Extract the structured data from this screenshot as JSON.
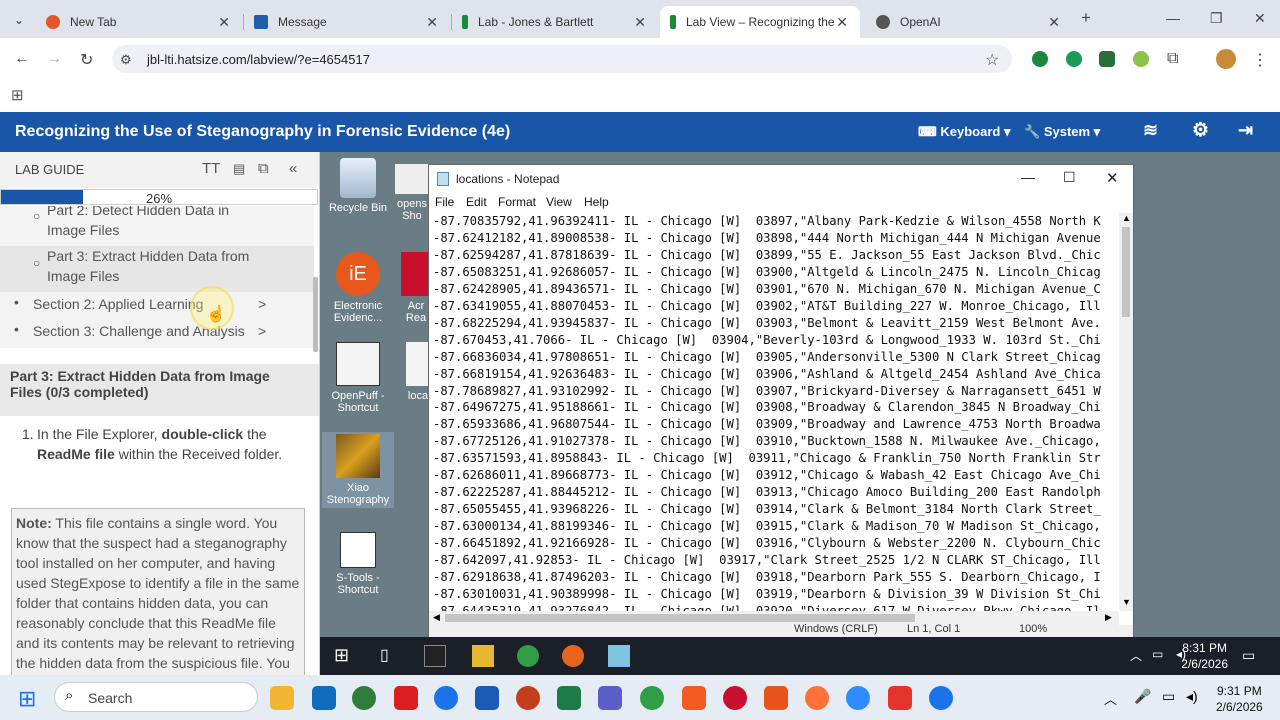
{
  "browser": {
    "tabs": [
      {
        "title": "New Tab",
        "favicon_color": "#e4572e"
      },
      {
        "title": "Message",
        "favicon_color": "#1f5fa8"
      },
      {
        "title": "Lab - Jones & Bartlett",
        "favicon_color": "#1a8a3a"
      },
      {
        "title": "Lab View – Recognizing the",
        "favicon_color": "#1a8a3a"
      },
      {
        "title": "OpenAI",
        "favicon_color": "#555555"
      }
    ],
    "url": "jbl-lti.hatsize.com/labview/?e=4654517"
  },
  "app": {
    "title": "Recognizing the Use of Steganography in Forensic Evidence (4e)",
    "keyboard": "Keyboard",
    "system": "System"
  },
  "lab_guide": {
    "title": "LAB GUIDE",
    "progress_percent": 26,
    "progress_label": "26%",
    "toc": {
      "part2": "Part 2: Detect Hidden Data in Image Files",
      "part3": "Part 3: Extract Hidden Data from Image Files",
      "section2": "Section 2: Applied Learning",
      "section3": "Section 3: Challenge and Analysis"
    },
    "part_heading": "Part 3: Extract Hidden Data from Image Files (0/3 completed)",
    "step_num": "1.",
    "step_pre": "In the File Explorer, ",
    "step_bold1": "double-click",
    "step_mid": " the ",
    "step_bold2": "ReadMe file",
    "step_post": " within the Received folder.",
    "note_label": "Note:",
    "note_text": " This file contains a single word. You know that the suspect had a steganography tool installed on her computer, and having used StegExpose to identify a file in the same folder that contains hidden data, you can reasonably conclude that this ReadMe file and its contents may be relevant to retrieving the hidden data from the suspicious file. You"
  },
  "desktop": {
    "icons": [
      {
        "label": "Recycle Bin"
      },
      {
        "label": "opens Sho"
      },
      {
        "label": "Electronic Evidenc..."
      },
      {
        "label": "Acr Rea"
      },
      {
        "label": "OpenPuff - Shortcut"
      },
      {
        "label": "loca"
      },
      {
        "label": "Xiao Stenography"
      },
      {
        "label": "S-Tools - Shortcut"
      }
    ]
  },
  "notepad": {
    "title": "locations - Notepad",
    "menu": [
      "File",
      "Edit",
      "Format",
      "View",
      "Help"
    ],
    "lines": [
      "-87.70835792,41.96392411- IL - Chicago [W]  03897,\"Albany Park-Kedzie & Wilson_4558 North K",
      "-87.62412182,41.89008538- IL - Chicago [W]  03898,\"444 North Michigan_444 N Michigan Avenue",
      "-87.62594287,41.87818639- IL - Chicago [W]  03899,\"55 E. Jackson_55 East Jackson Blvd._Chic",
      "-87.65083251,41.92686057- IL - Chicago [W]  03900,\"Altgeld & Lincoln_2475 N. Lincoln_Chicag",
      "-87.62428905,41.89436571- IL - Chicago [W]  03901,\"670 N. Michigan_670 N. Michigan Avenue_C",
      "-87.63419055,41.88070453- IL - Chicago [W]  03902,\"AT&T Building_227 W. Monroe_Chicago, Ill",
      "-87.68225294,41.93945837- IL - Chicago [W]  03903,\"Belmont & Leavitt_2159 West Belmont Ave.",
      "-87.670453,41.7066- IL - Chicago [W]  03904,\"Beverly-103rd & Longwood_1933 W. 103rd St._Chi",
      "-87.66836034,41.97808651- IL - Chicago [W]  03905,\"Andersonville_5300 N Clark Street_Chicag",
      "-87.66819154,41.92636483- IL - Chicago [W]  03906,\"Ashland & Altgeld_2454 Ashland Ave_Chica",
      "-87.78689827,41.93102992- IL - Chicago [W]  03907,\"Brickyard-Diversey & Narragansett_6451 W",
      "-87.64967275,41.95188661- IL - Chicago [W]  03908,\"Broadway & Clarendon_3845 N Broadway_Chi",
      "-87.65933686,41.96807544- IL - Chicago [W]  03909,\"Broadway and Lawrence_4753 North Broadwa",
      "-87.67725126,41.91027378- IL - Chicago [W]  03910,\"Bucktown_1588 N. Milwaukee Ave._Chicago,",
      "-87.63571593,41.8958843- IL - Chicago [W]  03911,\"Chicago & Franklin_750 North Franklin Str",
      "-87.62686011,41.89668773- IL - Chicago [W]  03912,\"Chicago & Wabash_42 East Chicago Ave_Chi",
      "-87.62225287,41.88445212- IL - Chicago [W]  03913,\"Chicago Amoco Building_200 East Randolph",
      "-87.65055455,41.93968226- IL - Chicago [W]  03914,\"Clark & Belmont_3184 North Clark Street_",
      "-87.63000134,41.88199346- IL - Chicago [W]  03915,\"Clark & Madison_70 W Madison St_Chicago,",
      "-87.66451892,41.92166928- IL - Chicago [W]  03916,\"Clybourn & Webster_2200 N. Clybourn_Chic",
      "-87.642097,41.92853- IL - Chicago [W]  03917,\"Clark Street_2525 1/2 N CLARK ST_Chicago, Ill",
      "-87.62918638,41.87496203- IL - Chicago [W]  03918,\"Dearborn Park_555 S. Dearborn_Chicago, I",
      "-87.63010031,41.90389998- IL - Chicago [W]  03919,\"Dearborn & Division_39 W Division St_Chi",
      "-87.64435319,41.93276842- IL - Chicago [W]  03920,\"Diversey_617 W Diversey Pkwy_Chicago, Il"
    ],
    "status": [
      "Windows (CRLF)",
      "Ln 1, Col 1",
      "100%"
    ]
  },
  "vm_taskbar": {
    "time": "8:31 PM",
    "date": "2/6/2026"
  },
  "host_taskbar": {
    "search_placeholder": "Search",
    "time": "9:31 PM",
    "date": "2/6/2026"
  }
}
